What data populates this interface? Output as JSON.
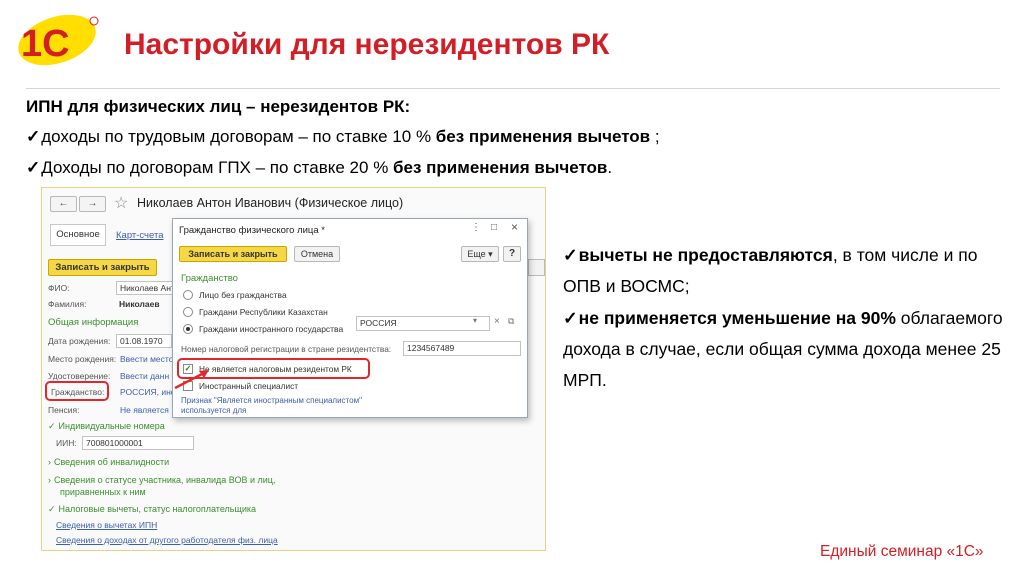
{
  "slide": {
    "title": "Настройки для нерезидентов РК",
    "heading": "ИПН для физических лиц – нерезидентов РК:",
    "check": "✓",
    "bullet1": {
      "text": "доходы по трудовым договорам – по ставке 10 % ",
      "bold": "без применения вычетов",
      "tail": " ;"
    },
    "bullet2": {
      "text": "Доходы по договорам ГПХ – по ставке 20 % ",
      "bold": "без применения вычетов",
      "tail": "."
    },
    "right1": {
      "bold": "вычеты не предоставляются",
      "text": ", в том числе и по ОПВ и ВОСМС;"
    },
    "right2": {
      "bold": "не применяется уменьшение на 90%",
      "text": " облагаемого дохода в случае, если общая сумма дохода менее 25 МРП."
    },
    "footer": "Единый семинар «1С»",
    "logo": {
      "text": "1С",
      "icon": "1c-logo-icon"
    },
    "accent_color": "#d21f27"
  },
  "window": {
    "back_glyph": "←",
    "forward_glyph": "→",
    "star_glyph": "☆",
    "title": "Николаев Антон Иванович (Физическое лицо)",
    "tab_main": "Основное",
    "tab_link": "Карт-счета",
    "save_close": "Записать и закрыть",
    "fields": {
      "fio_label": "ФИО:",
      "fio_value": "Николаев Антон",
      "surname_label": "Фамилия:",
      "surname_value": "Николаев",
      "general_info": "Общая информация",
      "dob_label": "Дата рождения:",
      "dob_value": "01.08.1970",
      "birthplace_label": "Место рождения:",
      "birthplace_value": "Ввести место",
      "id_label": "Удостоверение:",
      "id_value": "Ввести данн",
      "citizenship_label": "Гражданство:",
      "citizenship_value": "РОССИЯ, ино",
      "pension_label": "Пенсия:",
      "pension_value": "Не является"
    },
    "sections": {
      "individual_numbers": "Индивидуальные номера",
      "iin_label": "ИИН:",
      "iin_value": "700801000001",
      "disability": "Сведения об инвалидности",
      "veteran": "Сведения о статусе участника, инвалида ВОВ и лиц,",
      "veteran2": "приравненных к ним",
      "tax": "Налоговые вычеты, статус налогоплательщика",
      "link_ipn": "Сведения о вычетах ИПН",
      "link_income": "Сведения о доходах от другого работодателя физ. лица"
    },
    "chevron": "›",
    "checkmark": "✓"
  },
  "dialog": {
    "title": "Гражданство физического лица *",
    "save_close": "Записать и закрыть",
    "cancel": "Отмена",
    "more": "Еще",
    "help": "?",
    "menu_dots": "⋮",
    "minimize": "□",
    "close": "×",
    "section": "Гражданство",
    "opt1": "Лицо без гражданства",
    "opt2": "Граждани Республики Казахстан",
    "opt3": "Граждани иностранного государства",
    "country": "РОССИЯ",
    "country_clear": "×",
    "country_open": "⧉",
    "tax_reg_label": "Номер налоговой регистрации в стране резидентства:",
    "tax_reg_value": "1234567489",
    "nonresident": "Не является налоговым резидентом РК",
    "foreign_specialist": "Иностранный специалист",
    "hint": "Признак \"Является иностранным специалистом\"",
    "hint2": "используется для",
    "dropdown_glyph": "▾"
  }
}
